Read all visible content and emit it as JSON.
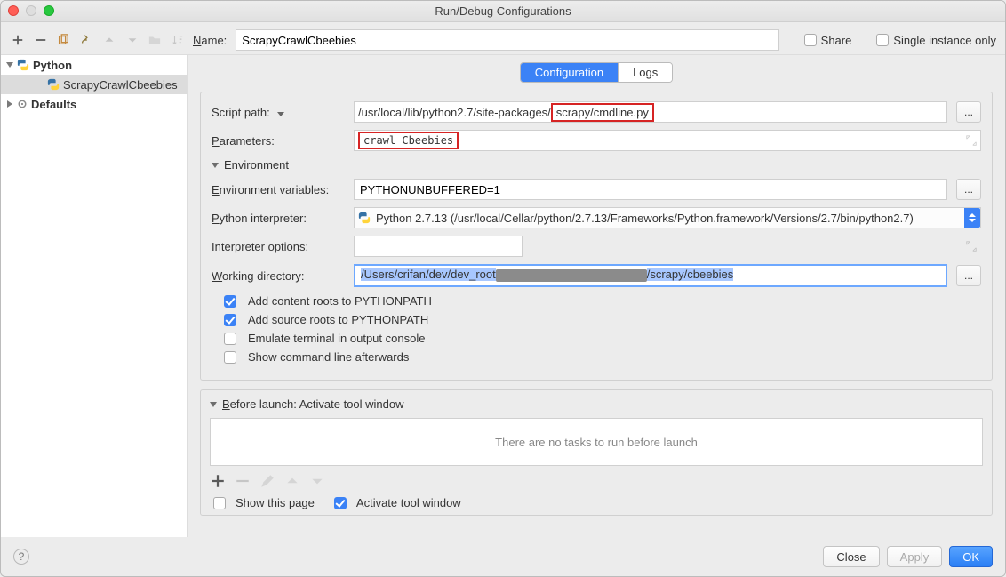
{
  "window_title": "Run/Debug Configurations",
  "toprow": {
    "name_label": "Name:",
    "name_value": "ScrapyCrawlCbeebies",
    "share_label": "Share",
    "single_instance_label": "Single instance only"
  },
  "sidebar": {
    "python_label": "Python",
    "config_label": "ScrapyCrawlCbeebies",
    "defaults_label": "Defaults"
  },
  "tabs": {
    "configuration": "Configuration",
    "logs": "Logs"
  },
  "fields": {
    "script_path_label": "Script path:",
    "script_path_prefix": "/usr/local/lib/python2.7/site-packages/",
    "script_path_highlight": "scrapy/cmdline.py",
    "parameters_label": "Parameters:",
    "parameters_value": "crawl Cbeebies",
    "environment_section": "Environment",
    "env_vars_label": "Environment variables:",
    "env_vars_value": "PYTHONUNBUFFERED=1",
    "interp_label": "Python interpreter:",
    "interp_value": "Python 2.7.13 (/usr/local/Cellar/python/2.7.13/Frameworks/Python.framework/Versions/2.7/bin/python2.7)",
    "interp_opts_label": "Interpreter options:",
    "interp_opts_value": "",
    "wd_label": "Working directory:",
    "wd_prefix": "/Users/crifan/dev/dev_root",
    "wd_suffix": "/scrapy/cbeebies",
    "chk_content_roots": "Add content roots to PYTHONPATH",
    "chk_source_roots": "Add source roots to PYTHONPATH",
    "chk_emulate": "Emulate terminal in output console",
    "chk_show_cmd": "Show command line afterwards"
  },
  "before": {
    "section": "Before launch: Activate tool window",
    "empty": "There are no tasks to run before launch",
    "show_page": "Show this page",
    "activate": "Activate tool window"
  },
  "buttons": {
    "browse": "...",
    "close": "Close",
    "apply": "Apply",
    "ok": "OK",
    "help": "?"
  }
}
